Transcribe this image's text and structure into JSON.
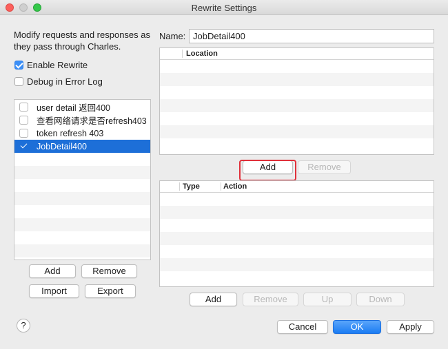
{
  "window": {
    "title": "Rewrite Settings"
  },
  "left": {
    "description": "Modify requests and responses as they pass through Charles.",
    "enable_rewrite": {
      "label": "Enable Rewrite",
      "checked": true
    },
    "debug_log": {
      "label": "Debug in Error Log",
      "checked": false
    },
    "rules": [
      {
        "label": "user detail 返回400",
        "checked": false,
        "selected": false
      },
      {
        "label": "查看网络请求是否refresh403",
        "checked": false,
        "selected": false
      },
      {
        "label": "token refresh 403",
        "checked": false,
        "selected": false
      },
      {
        "label": "JobDetail400",
        "checked": true,
        "selected": true
      }
    ],
    "buttons": {
      "add": "Add",
      "remove": "Remove",
      "import": "Import",
      "export": "Export"
    }
  },
  "right": {
    "name_label": "Name:",
    "name_value": "JobDetail400",
    "locations_table": {
      "columns": [
        "Location"
      ]
    },
    "location_buttons": {
      "add": "Add",
      "remove": "Remove"
    },
    "rules_table": {
      "columns": [
        "Type",
        "Action"
      ]
    },
    "rule_buttons": {
      "add": "Add",
      "remove": "Remove",
      "up": "Up",
      "down": "Down"
    }
  },
  "footer": {
    "help": "?",
    "cancel": "Cancel",
    "ok": "OK",
    "apply": "Apply"
  },
  "colors": {
    "selection": "#1d6fd8",
    "primary": "#1b7cf3",
    "highlight": "#e0303a"
  }
}
